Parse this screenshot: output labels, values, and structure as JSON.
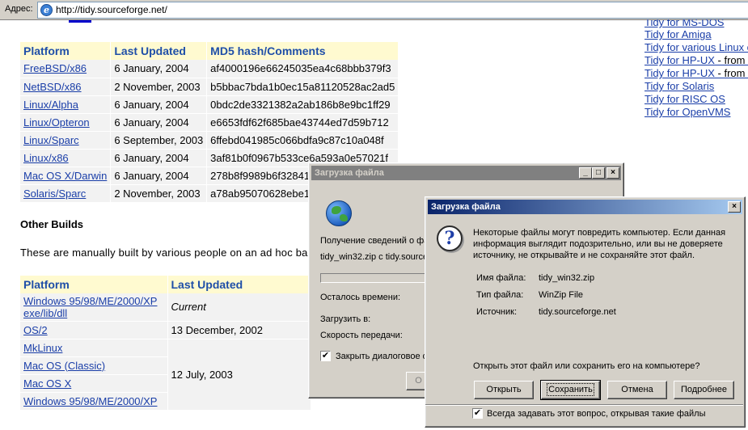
{
  "address_bar": {
    "label": "Адрес:",
    "url": "http://tidy.sourceforge.net/"
  },
  "table1": {
    "headers": [
      "Platform",
      "Last Updated",
      "MD5 hash/Comments"
    ],
    "rows": [
      {
        "platform": "FreeBSD/x86",
        "updated": "6 January, 2004",
        "md5": "af4000196e66245035ea4c68bbb379f3"
      },
      {
        "platform": "NetBSD/x86",
        "updated": "2 November, 2003",
        "md5": "b5bbac7bda1b0ec15a81120528ac2ad5"
      },
      {
        "platform": "Linux/Alpha",
        "updated": "6 January, 2004",
        "md5": "0bdc2de3321382a2ab186b8e9bc1ff29"
      },
      {
        "platform": "Linux/Opteron",
        "updated": "6 January, 2004",
        "md5": "e6653fdf62f685bae43744ed7d59b712"
      },
      {
        "platform": "Linux/Sparc",
        "updated": "6 September, 2003",
        "md5": "6ffebd041985c066bdfa9c87c10a048f"
      },
      {
        "platform": "Linux/x86",
        "updated": "6 January, 2004",
        "md5": "3af81b0f0967b533ce6a593a0e57021f"
      },
      {
        "platform": "Mac OS X/Darwin",
        "updated": "6 January, 2004",
        "md5": "278b8f9989b6f32841"
      },
      {
        "platform": "Solaris/Sparc",
        "updated": "2 November, 2003",
        "md5": "a78ab95070628ebe1"
      }
    ]
  },
  "other_builds": {
    "title": "Other Builds",
    "intro": "These are manually built by various people on an ad hoc basis"
  },
  "table2": {
    "headers": [
      "Platform",
      "Last Updated"
    ],
    "rows": [
      {
        "platform": "Windows 95/98/ME/2000/XP exe/lib/dll",
        "updated": "Current"
      },
      {
        "platform": "OS/2",
        "updated": "13 December, 2002"
      },
      {
        "platform": "MkLinux",
        "updated": ""
      },
      {
        "platform": "Mac OS (Classic)",
        "updated": "12 July, 2003"
      },
      {
        "platform": "Mac OS X",
        "updated": ""
      },
      {
        "platform": "Windows 95/98/ME/2000/XP",
        "updated": ""
      }
    ]
  },
  "right_links": {
    "partial_top": "Tidy for MS-DOS",
    "items": [
      {
        "label": "Tidy for Amiga",
        "suffix": ""
      },
      {
        "label": "Tidy for various Linux c",
        "suffix": ""
      },
      {
        "label": "Tidy for HP-UX",
        "suffix": " - from C"
      },
      {
        "label": "Tidy for HP-UX",
        "suffix": " - from I"
      },
      {
        "label": "Tidy for Solaris",
        "suffix": ""
      },
      {
        "label": "Tidy for RISC OS",
        "suffix": ""
      },
      {
        "label": "Tidy for OpenVMS",
        "suffix": ""
      }
    ]
  },
  "download_dialog": {
    "title": "Загрузка файла",
    "getting_info": "Получение сведений о фа",
    "file_from": "tidy_win32.zip с tidy.source",
    "time_left": "Осталось времени:",
    "download_to": "Загрузить в:",
    "speed": "Скорость передачи:",
    "close_checkbox": "Закрыть диалоговое о",
    "close_checked": "✔",
    "partial_button": "О",
    "progress_percent": 0
  },
  "save_dialog": {
    "title": "Загрузка файла",
    "warning": [
      "Некоторые файлы могут повредить компьютер. Если данная",
      "информация выглядит подозрительно, или вы не доверяете",
      "источнику, не открывайте и не сохраняйте этот файл."
    ],
    "file_name_label": "Имя файла:",
    "file_name": "tidy_win32.zip",
    "file_type_label": "Тип файла:",
    "file_type": "WinZip File",
    "source_label": "Источник:",
    "source": "tidy.sourceforge.net",
    "question": "Открыть этот файл или сохранить его на компьютере?",
    "buttons": {
      "open": "Открыть",
      "save": "Сохранить",
      "cancel": "Отмена",
      "details": "Подробнее"
    },
    "always_ask": "Всегда задавать этот вопрос, открывая такие файлы",
    "always_checked": "✔",
    "question_glyph": "?"
  },
  "titlebar_glyphs": {
    "minimize": "_",
    "maximize": "□",
    "close": "×"
  }
}
